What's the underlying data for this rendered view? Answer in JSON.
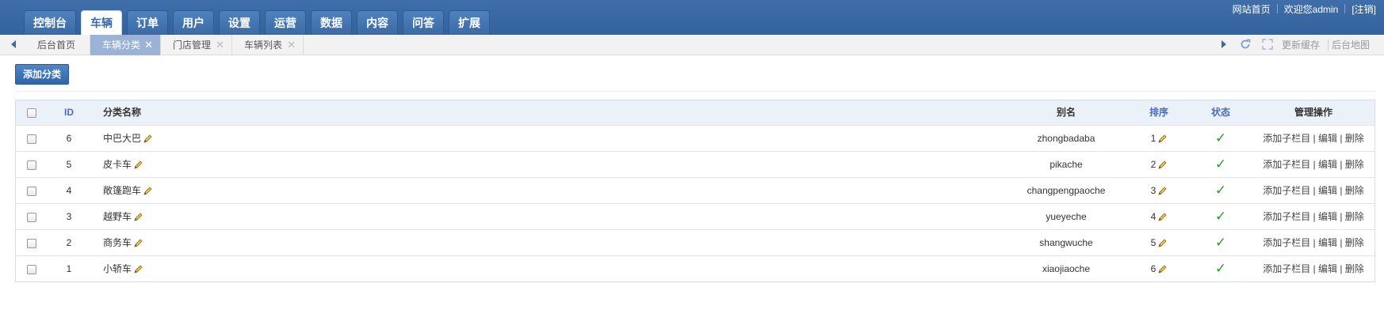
{
  "nav": {
    "tabs": [
      {
        "label": "控制台",
        "active": false
      },
      {
        "label": "车辆",
        "active": true
      },
      {
        "label": "订单",
        "active": false
      },
      {
        "label": "用户",
        "active": false
      },
      {
        "label": "设置",
        "active": false
      },
      {
        "label": "运营",
        "active": false
      },
      {
        "label": "数据",
        "active": false
      },
      {
        "label": "内容",
        "active": false
      },
      {
        "label": "问答",
        "active": false
      },
      {
        "label": "扩展",
        "active": false
      }
    ]
  },
  "toplinks": {
    "home": "网站首页",
    "welcome": "欢迎您admin",
    "logout": "[注销]"
  },
  "tabbar": {
    "tabs": [
      {
        "label": "后台首页",
        "active": false,
        "closable": false
      },
      {
        "label": "车辆分类",
        "active": true,
        "closable": true
      },
      {
        "label": "门店管理",
        "active": false,
        "closable": true
      },
      {
        "label": "车辆列表",
        "active": false,
        "closable": true
      }
    ],
    "close_glyph": "✕",
    "refresh_cache": "更新缓存",
    "admin_map": "后台地图"
  },
  "toolbar": {
    "add_label": "添加分类"
  },
  "table": {
    "headers": {
      "id": "ID",
      "name": "分类名称",
      "alias": "别名",
      "sort": "排序",
      "status": "状态",
      "ops": "管理操作"
    },
    "rows": [
      {
        "id": "6",
        "name": "中巴大巴",
        "alias": "zhongbadaba",
        "sort": "1",
        "status": "✓",
        "ops": "添加子栏目 | 编辑 | 删除"
      },
      {
        "id": "5",
        "name": "皮卡车",
        "alias": "pikache",
        "sort": "2",
        "status": "✓",
        "ops": "添加子栏目 | 编辑 | 删除"
      },
      {
        "id": "4",
        "name": "敞篷跑车",
        "alias": "changpengpaoche",
        "sort": "3",
        "status": "✓",
        "ops": "添加子栏目 | 编辑 | 删除"
      },
      {
        "id": "3",
        "name": "越野车",
        "alias": "yueyeche",
        "sort": "4",
        "status": "✓",
        "ops": "添加子栏目 | 编辑 | 删除"
      },
      {
        "id": "2",
        "name": "商务车",
        "alias": "shangwuche",
        "sort": "5",
        "status": "✓",
        "ops": "添加子栏目 | 编辑 | 删除"
      },
      {
        "id": "1",
        "name": "小轿车",
        "alias": "xiaojiaoche",
        "sort": "6",
        "status": "✓",
        "ops": "添加子栏目 | 编辑 | 删除"
      }
    ]
  },
  "colors": {
    "topbar": "#3a6aa4",
    "active_tab": "#9cb3d6",
    "check_green": "#2b9a2b",
    "header_blue_text": "#4a6fb8"
  }
}
